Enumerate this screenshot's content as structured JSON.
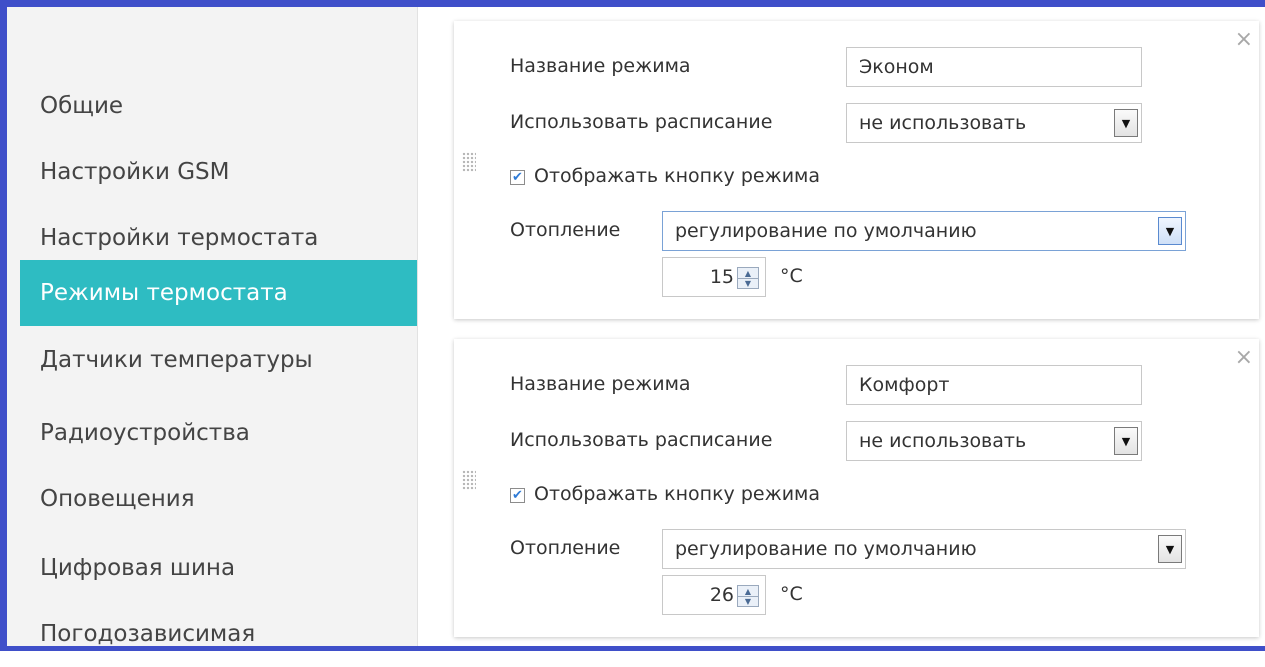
{
  "sidebar": {
    "items": [
      {
        "label": "Общие",
        "active": false
      },
      {
        "label": "Настройки GSM",
        "active": false
      },
      {
        "label": "Настройки термостата",
        "active": false
      },
      {
        "label": "Режимы термостата",
        "active": true
      },
      {
        "label": "Датчики температуры",
        "active": false
      },
      {
        "label": "Радиоустройства",
        "active": false
      },
      {
        "label": "Оповещения",
        "active": false
      },
      {
        "label": "Цифровая шина",
        "active": false
      },
      {
        "label": "Погодозависимая",
        "active": false
      }
    ]
  },
  "modes": [
    {
      "name_label": "Название режима",
      "name_value": "Эконом",
      "schedule_label": "Использовать расписание",
      "schedule_value": "не использовать",
      "show_button_label": "Отображать кнопку режима",
      "show_button_checked": true,
      "heating_label": "Отопление",
      "heating_value": "регулирование по умолчанию",
      "temperature": "15",
      "unit": "°C",
      "close_symbol": "×"
    },
    {
      "name_label": "Название режима",
      "name_value": "Комфорт",
      "schedule_label": "Использовать расписание",
      "schedule_value": "не использовать",
      "show_button_label": "Отображать кнопку режима",
      "show_button_checked": true,
      "heating_label": "Отопление",
      "heating_value": "регулирование по умолчанию",
      "temperature": "26",
      "unit": "°C",
      "close_symbol": "×"
    }
  ],
  "icons": {
    "checkmark": "✔",
    "dropdown_arrow": "▼",
    "spin_up": "▲",
    "spin_down": "▼"
  },
  "colors": {
    "accent": "#2ebcc2",
    "frame": "#3f4fc9",
    "checkmark": "#2f7bd6"
  }
}
